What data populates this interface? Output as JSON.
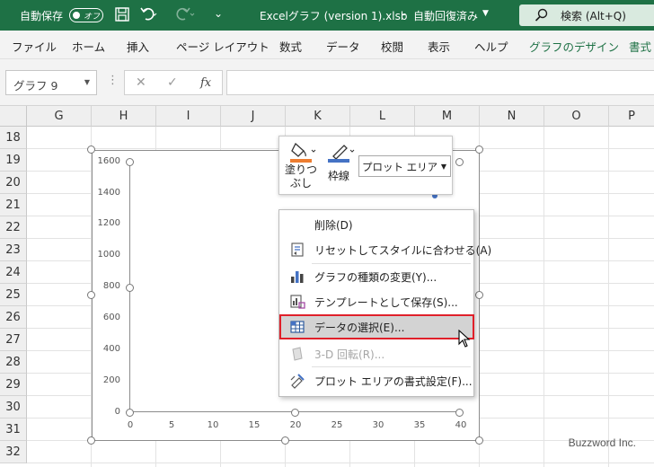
{
  "titlebar": {
    "autosave_label": "自動保存",
    "autosave_state": "オフ",
    "filename": "Excelグラフ (version 1).xlsb",
    "separator": "-",
    "save_status": "自動回復済み",
    "search_label": "検索 (Alt+Q)",
    "qa_more": "⌄"
  },
  "tabs": [
    "ファイル",
    "ホーム",
    "挿入",
    "ページ レイアウト",
    "数式",
    "データ",
    "校閲",
    "表示",
    "ヘルプ",
    "グラフのデザイン",
    "書式"
  ],
  "formula_bar": {
    "name_box": "グラフ 9",
    "cancel": "✕",
    "enter": "✓",
    "fx": "fx"
  },
  "columns": [
    "G",
    "H",
    "I",
    "J",
    "K",
    "L",
    "M",
    "N",
    "O",
    "P"
  ],
  "rows": [
    "18",
    "19",
    "20",
    "21",
    "22",
    "23",
    "24",
    "25",
    "26",
    "27",
    "28",
    "29",
    "30",
    "31",
    "32"
  ],
  "chart_data": {
    "type": "scatter",
    "title": "",
    "xlabel": "",
    "ylabel": "",
    "xlim": [
      0,
      40
    ],
    "ylim": [
      0,
      1600
    ],
    "x_ticks": [
      "0",
      "5",
      "10",
      "15",
      "20",
      "25",
      "30",
      "35",
      "40"
    ],
    "y_ticks": [
      "0",
      "200",
      "400",
      "600",
      "800",
      "1000",
      "1200",
      "1400",
      "1600"
    ],
    "series": []
  },
  "mini_toolbar": {
    "fill_label_line1": "塗りつ",
    "fill_label_line2": "ぶし",
    "outline_label": "枠線",
    "element_select": "プロット エリア",
    "fill_color": "#ed7d31",
    "outline_color": "#4472c4"
  },
  "context_menu": {
    "items": [
      {
        "label": "削除(D)",
        "icon": "none"
      },
      {
        "label": "リセットしてスタイルに合わせる(A)",
        "icon": "reset-style-icon"
      },
      {
        "label": "グラフの種類の変更(Y)...",
        "icon": "chart-type-icon"
      },
      {
        "label": "テンプレートとして保存(S)...",
        "icon": "template-icon"
      },
      {
        "label": "データの選択(E)...",
        "icon": "select-data-icon",
        "state": "highlighted"
      },
      {
        "label": "3-D 回転(R)...",
        "icon": "rotate-3d-icon",
        "state": "disabled"
      },
      {
        "label": "プロット エリアの書式設定(F)...",
        "icon": "format-icon"
      }
    ]
  },
  "watermark": "Buzzword Inc."
}
